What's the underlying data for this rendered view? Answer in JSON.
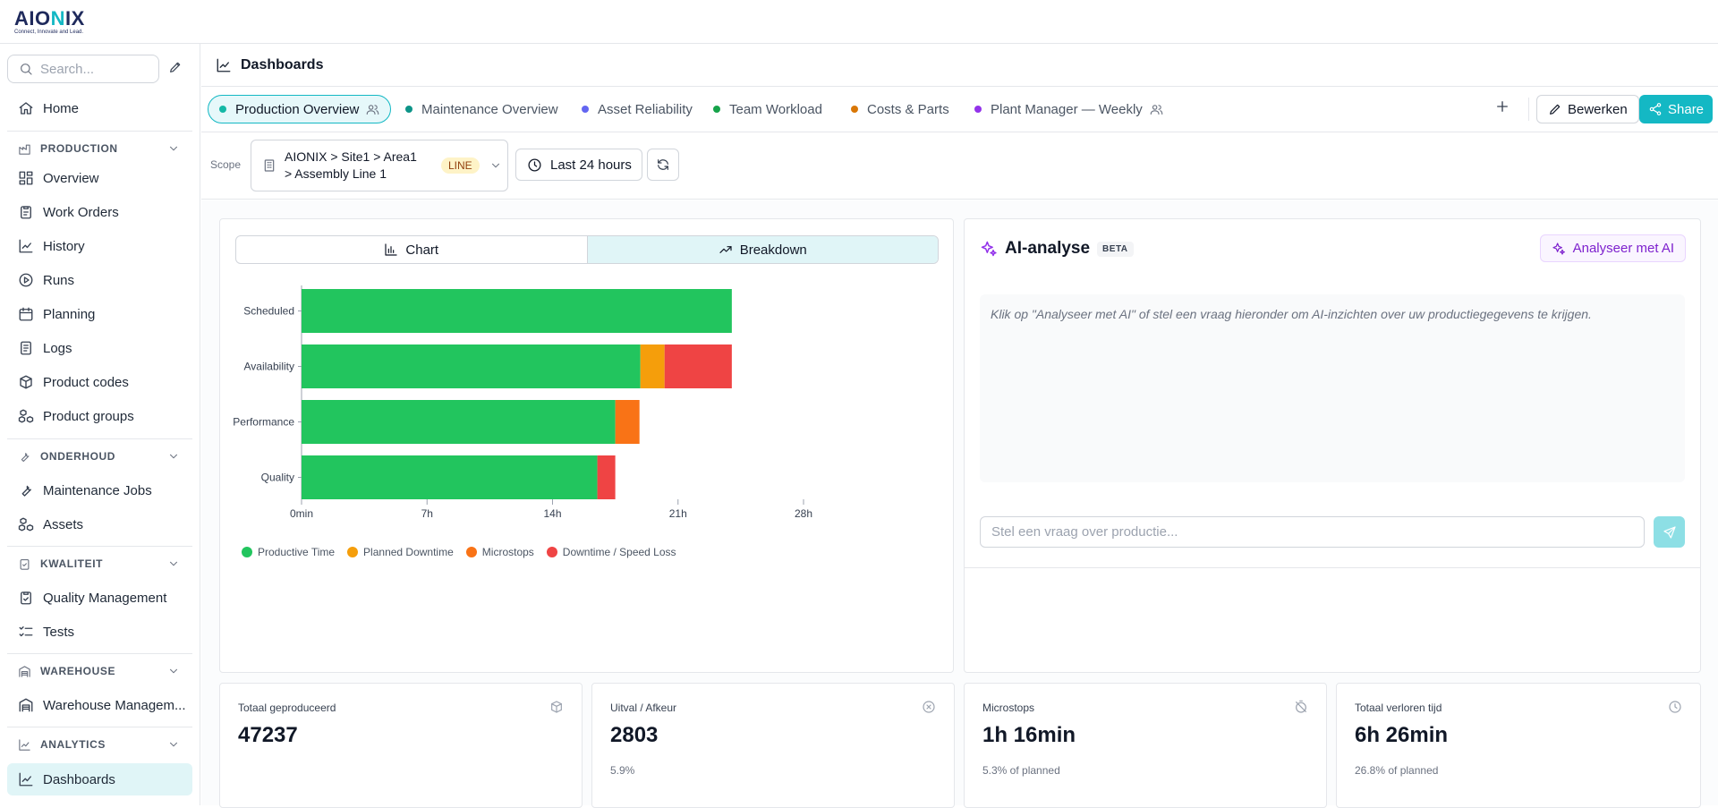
{
  "app": {
    "logo": "AIONIX",
    "tagline": "Connect, Innovate and Lead."
  },
  "sidebar": {
    "search_placeholder": "Search...",
    "home": "Home",
    "sections": {
      "production": {
        "title": "PRODUCTION",
        "items": [
          "Overview",
          "Work Orders",
          "History",
          "Runs",
          "Planning",
          "Logs",
          "Product codes",
          "Product groups"
        ]
      },
      "onderhoud": {
        "title": "ONDERHOUD",
        "items": [
          "Maintenance Jobs",
          "Assets"
        ]
      },
      "kwaliteit": {
        "title": "KWALITEIT",
        "items": [
          "Quality Management",
          "Tests"
        ]
      },
      "warehouse": {
        "title": "WAREHOUSE",
        "items": [
          "Warehouse Managem..."
        ]
      },
      "analytics": {
        "title": "ANALYTICS",
        "items": [
          "Dashboards"
        ]
      }
    }
  },
  "header": {
    "title": "Dashboards"
  },
  "tabs": [
    {
      "label": "Production Overview",
      "dot": "#14b8a6",
      "shared": true
    },
    {
      "label": "Maintenance Overview",
      "dot": "#0d9488",
      "shared": false
    },
    {
      "label": "Asset Reliability",
      "dot": "#6366f1",
      "shared": false
    },
    {
      "label": "Team Workload",
      "dot": "#16a34a",
      "shared": false
    },
    {
      "label": "Costs & Parts",
      "dot": "#d97706",
      "shared": false
    },
    {
      "label": "Plant Manager — Weekly",
      "dot": "#9333ea",
      "shared": true
    }
  ],
  "actions": {
    "edit": "Bewerken",
    "share": "Share"
  },
  "scope": {
    "label": "Scope",
    "path_line1": "AIONIX > Site1 > Area1",
    "path_line2": "> Assembly Line 1",
    "badge": "LINE",
    "time_range": "Last 24 hours"
  },
  "chart_toggle": {
    "chart": "Chart",
    "breakdown": "Breakdown",
    "active": "breakdown"
  },
  "chart_data": {
    "type": "bar",
    "orientation": "horizontal",
    "stacked": true,
    "categories": [
      "Scheduled",
      "Availability",
      "Performance",
      "Quality"
    ],
    "x_ticks": [
      "0min",
      "7h",
      "14h",
      "21h",
      "28h"
    ],
    "xlim_hours": [
      0,
      28
    ],
    "unit": "hours",
    "series": [
      {
        "name": "Productive Time",
        "color": "#22c55e",
        "values": [
          24,
          18.9,
          17.5,
          16.5
        ]
      },
      {
        "name": "Planned Downtime",
        "color": "#f59e0b",
        "values": [
          0,
          1.35,
          0,
          0
        ]
      },
      {
        "name": "Microstops",
        "color": "#f97316",
        "values": [
          0,
          0,
          1.35,
          0
        ]
      },
      {
        "name": "Downtime / Speed Loss",
        "color": "#ef4444",
        "values": [
          0,
          3.75,
          0,
          1.0
        ]
      }
    ],
    "legend_position": "bottom-left"
  },
  "ai": {
    "title": "AI-analyse",
    "badge": "BETA",
    "button": "Analyseer met AI",
    "message": "Klik op \"Analyseer met AI\" of stel een vraag hieronder om AI-inzichten over uw productiegegevens te krijgen.",
    "input_placeholder": "Stel een vraag over productie..."
  },
  "kpis": [
    {
      "label": "Totaal geproduceerd",
      "value": "47237",
      "sub": "",
      "icon": "package-icon"
    },
    {
      "label": "Uitval / Afkeur",
      "value": "2803",
      "sub": "5.9%",
      "icon": "x-circle-icon"
    },
    {
      "label": "Microstops",
      "value": "1h 16min",
      "sub": "5.3% of planned",
      "icon": "timer-off-icon"
    },
    {
      "label": "Totaal verloren tijd",
      "value": "6h 26min",
      "sub": "26.8% of planned",
      "icon": "clock-icon"
    }
  ]
}
